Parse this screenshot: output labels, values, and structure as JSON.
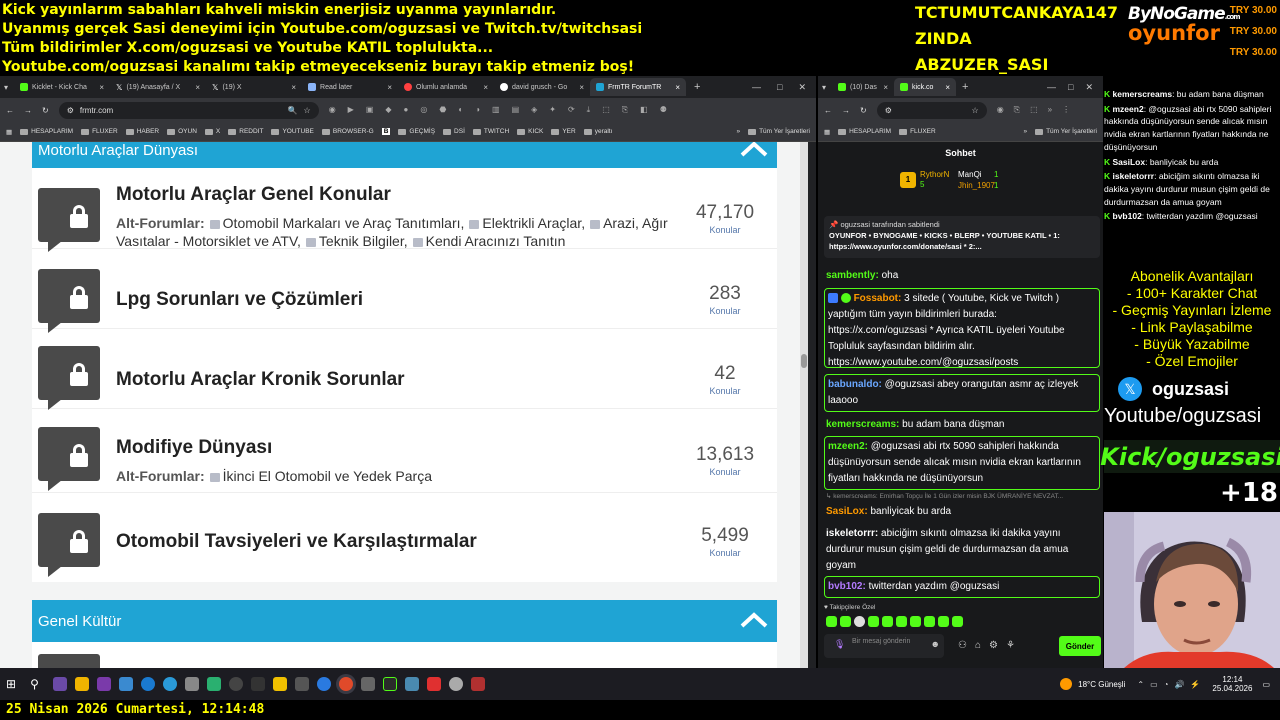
{
  "overlay": {
    "lines": [
      "Kick yayınlarım sabahları kahveli miskin enerjisiz uyanma yayınlarıdır.",
      "Uyanmış gerçek Sasi deneyimi için Youtube.com/oguzsasi ve Twitch.tv/twitchsasi",
      "Tüm bildirimler X.com/oguzsasi ve Youtube KATIL toplulukta...",
      "Youtube.com/oguzsasi kanalımı takip etmeyecekseniz burayı takip etmeniz boş!"
    ],
    "names": [
      "TCTUMUTCANKAYA147",
      "ZINDA",
      "ABZUZER_SASI"
    ],
    "logo_top": "ByNoGame",
    "logo_com": ".com",
    "logo_bottom": "oyunfor",
    "donations": [
      "TRY 30.00",
      "TRY 30.00",
      "TRY 30.00"
    ]
  },
  "left_browser": {
    "tabs": [
      "Kicklet - Kick Cha",
      "(19) Anasayfa / X",
      "(19) X",
      "Read later",
      "Olumlu anlamda",
      "david grusch - Go",
      "FrmTR ForumTR"
    ],
    "url": "frmtr.com",
    "bookmarks": [
      "HESAPLARIM",
      "FLUXER",
      "HABER",
      "OYUN",
      "X",
      "REDDIT",
      "YOUTUBE",
      "BROWSER-G",
      "B",
      "GEÇMİŞ",
      "DSİ",
      "TWITCH",
      "KICK",
      "YER",
      "yeraltı",
      "Tüm Yer İşaretleri"
    ]
  },
  "forum": {
    "section1": "Motorlu Araçlar Dünyası",
    "section2": "Genel Kültür",
    "rows": [
      {
        "title": "Motorlu Araçlar Genel Konular",
        "sub_label": "Alt-Forumlar:",
        "subs": [
          "Otomobil Markaları ve Araç Tanıtımları,",
          "Elektrikli Araçlar,",
          "Arazi, Ağır Vasıtalar - Motorsiklet ve ATV,",
          "Teknik Bilgiler,",
          "Kendi Aracınızı Tanıtın"
        ],
        "count": "47,170",
        "count_label": "Konular"
      },
      {
        "title": "Lpg Sorunları ve Çözümleri",
        "count": "283",
        "count_label": "Konular"
      },
      {
        "title": "Motorlu Araçlar Kronik Sorunlar",
        "count": "42",
        "count_label": "Konular"
      },
      {
        "title": "Modifiye Dünyası",
        "sub_label": "Alt-Forumlar:",
        "subs": [
          "İkinci El Otomobil ve Yedek Parça"
        ],
        "count": "13,613",
        "count_label": "Konular"
      },
      {
        "title": "Otomobil Tavsiyeleri ve Karşılaştırmalar",
        "count": "5,499",
        "count_label": "Konular"
      }
    ]
  },
  "right_browser": {
    "tabs": [
      "(10) Das",
      "kick.co"
    ],
    "bookmarks": [
      "HESAPLARIM",
      "FLUXER",
      "Tüm Yer İşaretleri"
    ]
  },
  "chat": {
    "title": "Sohbet",
    "leaders": [
      {
        "name": "RythorN",
        "value": "5"
      },
      {
        "name": "ManQi",
        "value": "1"
      },
      {
        "name": "Jhin_1907",
        "value": "1"
      }
    ],
    "pinned_by": "oguzsasi tarafından sabitlendi",
    "pinned_text": "OYUNFOR • BYNOGAME • KICKS • BLERP • YOUTUBE KATIL • 1: https://www.oyunfor.com/donate/sasi * 2:...",
    "messages": [
      {
        "user": "sambently:",
        "text": "oha",
        "color": "#53fc18"
      },
      {
        "user": "Fossabot:",
        "text": "3 sitede ( Youtube, Kick ve Twitch ) yaptığım tüm yayın bildirimleri burada: https://x.com/oguzsasi * Ayrıca KATIL üyeleri Youtube Topluluk sayfasından bildirim alır. https://www.youtube.com/@oguzsasi/posts",
        "color": "#ff9a00"
      },
      {
        "user": "babunaldo:",
        "text": "@oguzsasi abey orangutan asmr aç izleyek laaooo",
        "color": "#6aa7ff"
      },
      {
        "user": "kemerscreams:",
        "text": "bu adam bana düşman",
        "color": "#53fc18"
      },
      {
        "user": "mzeen2:",
        "text": "@oguzsasi abi rtx 5090 sahipleri hakkında düşünüyorsun sende alıcak mısın nvidia ekran kartlarının fiyatları hakkında ne düşünüyorsun",
        "color": "#53fc18"
      },
      {
        "reply": "kemerscreams: Emirhan Topçu İle 1 Gün izler misin BJK ÜMRANİYE NEVZAT..."
      },
      {
        "user": "SasiLox:",
        "text": "banliyicak bu arda",
        "color": "#ff9a00"
      },
      {
        "user": "iskeletorrr:",
        "text": "abiciğim sıkıntı olmazsa iki dakika yayını durdurur musun çişim geldi de durdurmazsan da amua goyam",
        "color": "#ffffff"
      },
      {
        "user": "bvb102:",
        "text": "twitterdan yazdım @oguzsasi",
        "color": "#b47bff"
      }
    ],
    "followers_only": "Takipçilere Özel",
    "input_placeholder": "Bir mesaj gönderin",
    "send": "Gönder"
  },
  "right_overlay": {
    "chat": [
      {
        "user": "kemerscreams",
        "text": ": bu adam bana düşman"
      },
      {
        "user": "mzeen2",
        "text": ": @oguzsasi abi rtx 5090 sahipleri hakkında düşünüyorsun sende alıcak mısın nvidia ekran kartlarının fiyatları hakkında ne düşünüyorsun"
      },
      {
        "user": "SasiLox",
        "text": ": banliyicak bu arda"
      },
      {
        "user": "iskeletorrr",
        "text": ": abiciğim sıkıntı olmazsa iki dakika yayını durdurur musun çişim geldi de durdurmazsan da amua goyam"
      },
      {
        "user": "bvb102",
        "text": ": twitterdan yazdım @oguzsasi"
      }
    ],
    "promo": [
      "Abonelik Avantajları",
      "- 100+ Karakter Chat",
      "- Geçmiş Yayınları İzleme",
      "- Link Paylaşabilme",
      "- Büyük Yazabilme",
      "- Özel Emojiler"
    ],
    "x_handle": "oguzsasi",
    "youtube": "Youtube/oguzsasi",
    "kick": "Kick/oguzsasi",
    "age": "+18"
  },
  "taskbar": {
    "weather": "18°C Güneşli",
    "time": "12:14",
    "date": "25.04.2026"
  },
  "bottom_date": "25 Nisan 2026 Cumartesi, 12:14:48"
}
